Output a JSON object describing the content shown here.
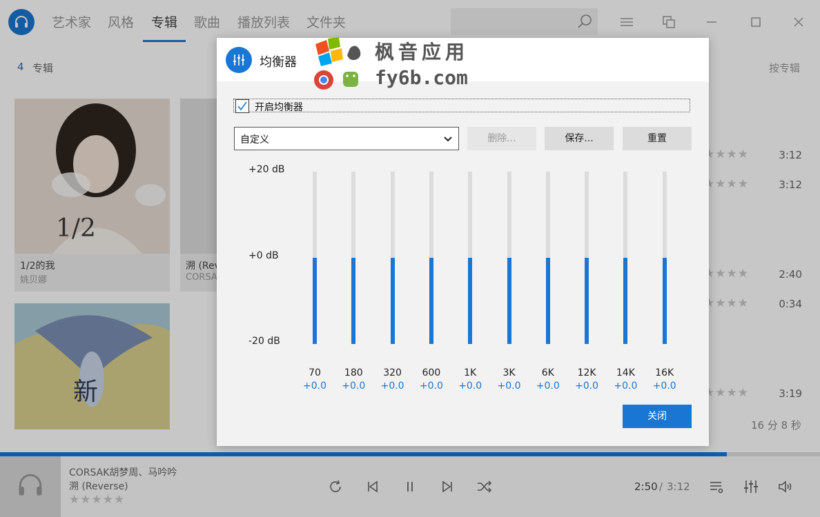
{
  "nav": {
    "tabs": [
      "艺术家",
      "风格",
      "专辑",
      "歌曲",
      "播放列表",
      "文件夹"
    ],
    "active_index": 2
  },
  "search": {
    "placeholder": ""
  },
  "library": {
    "album_count": "4",
    "album_count_label": "专辑",
    "sort_label": "按专辑",
    "albums": [
      {
        "title": "1/2的我",
        "artist": "姚贝娜"
      },
      {
        "title": "溯 (Rev",
        "artist": "CORSA"
      },
      {
        "title": "",
        "artist": ""
      }
    ],
    "songs": [
      {
        "stars": "★★★★",
        "duration": "3:12"
      },
      {
        "stars": "★★★★",
        "duration": "3:12"
      },
      {
        "stars": "★★★★",
        "duration": "2:40"
      },
      {
        "stars": "★★★★",
        "duration": "0:34"
      },
      {
        "stars": "★★★★",
        "duration": "3:19"
      }
    ],
    "total_time": "16 分 8 秒"
  },
  "player": {
    "artist": "CORSAK胡梦周、马吟吟",
    "song": "溯 (Reverse)",
    "stars": "★★★★★",
    "current_time": "2:50",
    "time_separator": "/",
    "total_time": "3:12",
    "progress_fraction": 0.886
  },
  "equalizer": {
    "title": "均衡器",
    "enable_label": "开启均衡器",
    "enabled": true,
    "preset_value": "自定义",
    "delete_label": "删除...",
    "save_label": "保存...",
    "reset_label": "重置",
    "close_label": "关闭",
    "db_max_label": "+20 dB",
    "db_mid_label": "+0 dB",
    "db_min_label": "-20 dB",
    "gain_range_db": [
      -20,
      20
    ],
    "bands": [
      {
        "freq": "70",
        "gain_label": "+0.0",
        "gain_db": 0
      },
      {
        "freq": "180",
        "gain_label": "+0.0",
        "gain_db": 0
      },
      {
        "freq": "320",
        "gain_label": "+0.0",
        "gain_db": 0
      },
      {
        "freq": "600",
        "gain_label": "+0.0",
        "gain_db": 0
      },
      {
        "freq": "1K",
        "gain_label": "+0.0",
        "gain_db": 0
      },
      {
        "freq": "3K",
        "gain_label": "+0.0",
        "gain_db": 0
      },
      {
        "freq": "6K",
        "gain_label": "+0.0",
        "gain_db": 0
      },
      {
        "freq": "12K",
        "gain_label": "+0.0",
        "gain_db": 0
      },
      {
        "freq": "14K",
        "gain_label": "+0.0",
        "gain_db": 0
      },
      {
        "freq": "16K",
        "gain_label": "+0.0",
        "gain_db": 0
      }
    ]
  },
  "watermark": {
    "line1": "枫音应用",
    "line2": "fy6b.com"
  },
  "colors": {
    "accent": "#1976d2",
    "overlay": "rgba(0,0,0,0.22)"
  }
}
